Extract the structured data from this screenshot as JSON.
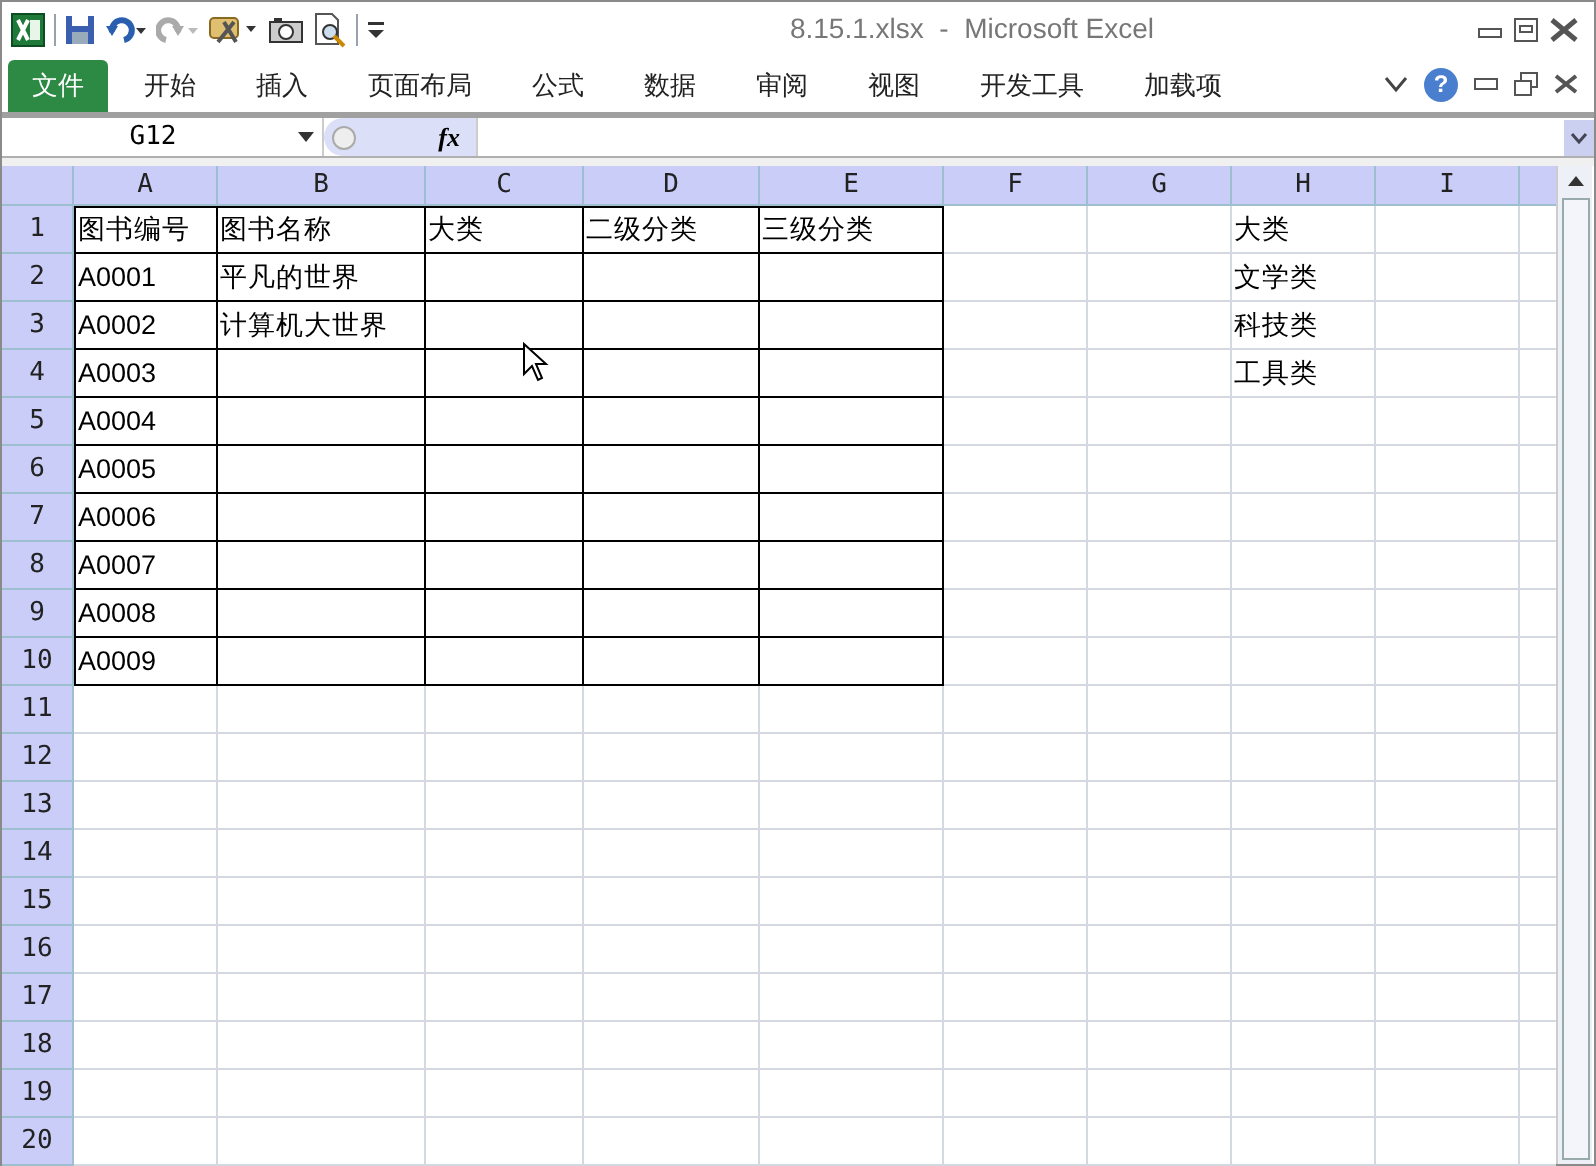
{
  "window": {
    "title": "8.15.1.xlsx  -  Microsoft Excel"
  },
  "tabs": [
    {
      "label": "文件",
      "selected": true
    },
    {
      "label": "开始",
      "selected": false
    },
    {
      "label": "插入",
      "selected": false
    },
    {
      "label": "页面布局",
      "selected": false
    },
    {
      "label": "公式",
      "selected": false
    },
    {
      "label": "数据",
      "selected": false
    },
    {
      "label": "审阅",
      "selected": false
    },
    {
      "label": "视图",
      "selected": false
    },
    {
      "label": "开发工具",
      "selected": false
    },
    {
      "label": "加载项",
      "selected": false
    }
  ],
  "help_button": "?",
  "formula_bar": {
    "name_box": "G12",
    "fx_label": "fx"
  },
  "sheet": {
    "columns": [
      "A",
      "B",
      "C",
      "D",
      "E",
      "F",
      "G",
      "H",
      "I"
    ],
    "rows": [
      {
        "number": "1",
        "bordered": true,
        "cells": {
          "A": "图书编号",
          "B": "图书名称",
          "C": "大类",
          "D": "二级分类",
          "E": "三级分类",
          "H": "大类"
        }
      },
      {
        "number": "2",
        "bordered": true,
        "cells": {
          "A": "A0001",
          "B": "平凡的世界",
          "H": "文学类"
        }
      },
      {
        "number": "3",
        "bordered": true,
        "cells": {
          "A": "A0002",
          "B": "计算机大世界",
          "H": "科技类"
        }
      },
      {
        "number": "4",
        "bordered": true,
        "cells": {
          "A": "A0003",
          "H": "工具类"
        }
      },
      {
        "number": "5",
        "bordered": true,
        "cells": {
          "A": "A0004"
        }
      },
      {
        "number": "6",
        "bordered": true,
        "cells": {
          "A": "A0005"
        }
      },
      {
        "number": "7",
        "bordered": true,
        "cells": {
          "A": "A0006"
        }
      },
      {
        "number": "8",
        "bordered": true,
        "cells": {
          "A": "A0007"
        }
      },
      {
        "number": "9",
        "bordered": true,
        "cells": {
          "A": "A0008"
        }
      },
      {
        "number": "10",
        "bordered": true,
        "cells": {
          "A": "A0009"
        }
      },
      {
        "number": "11",
        "bordered": false,
        "cells": {}
      },
      {
        "number": "12",
        "bordered": false,
        "cells": {}
      },
      {
        "number": "13",
        "bordered": false,
        "cells": {}
      },
      {
        "number": "14",
        "bordered": false,
        "cells": {}
      },
      {
        "number": "15",
        "bordered": false,
        "cells": {}
      },
      {
        "number": "16",
        "bordered": false,
        "cells": {}
      },
      {
        "number": "17",
        "bordered": false,
        "cells": {}
      },
      {
        "number": "18",
        "bordered": false,
        "cells": {}
      },
      {
        "number": "19",
        "bordered": false,
        "cells": {}
      },
      {
        "number": "20",
        "bordered": false,
        "cells": {}
      }
    ]
  }
}
